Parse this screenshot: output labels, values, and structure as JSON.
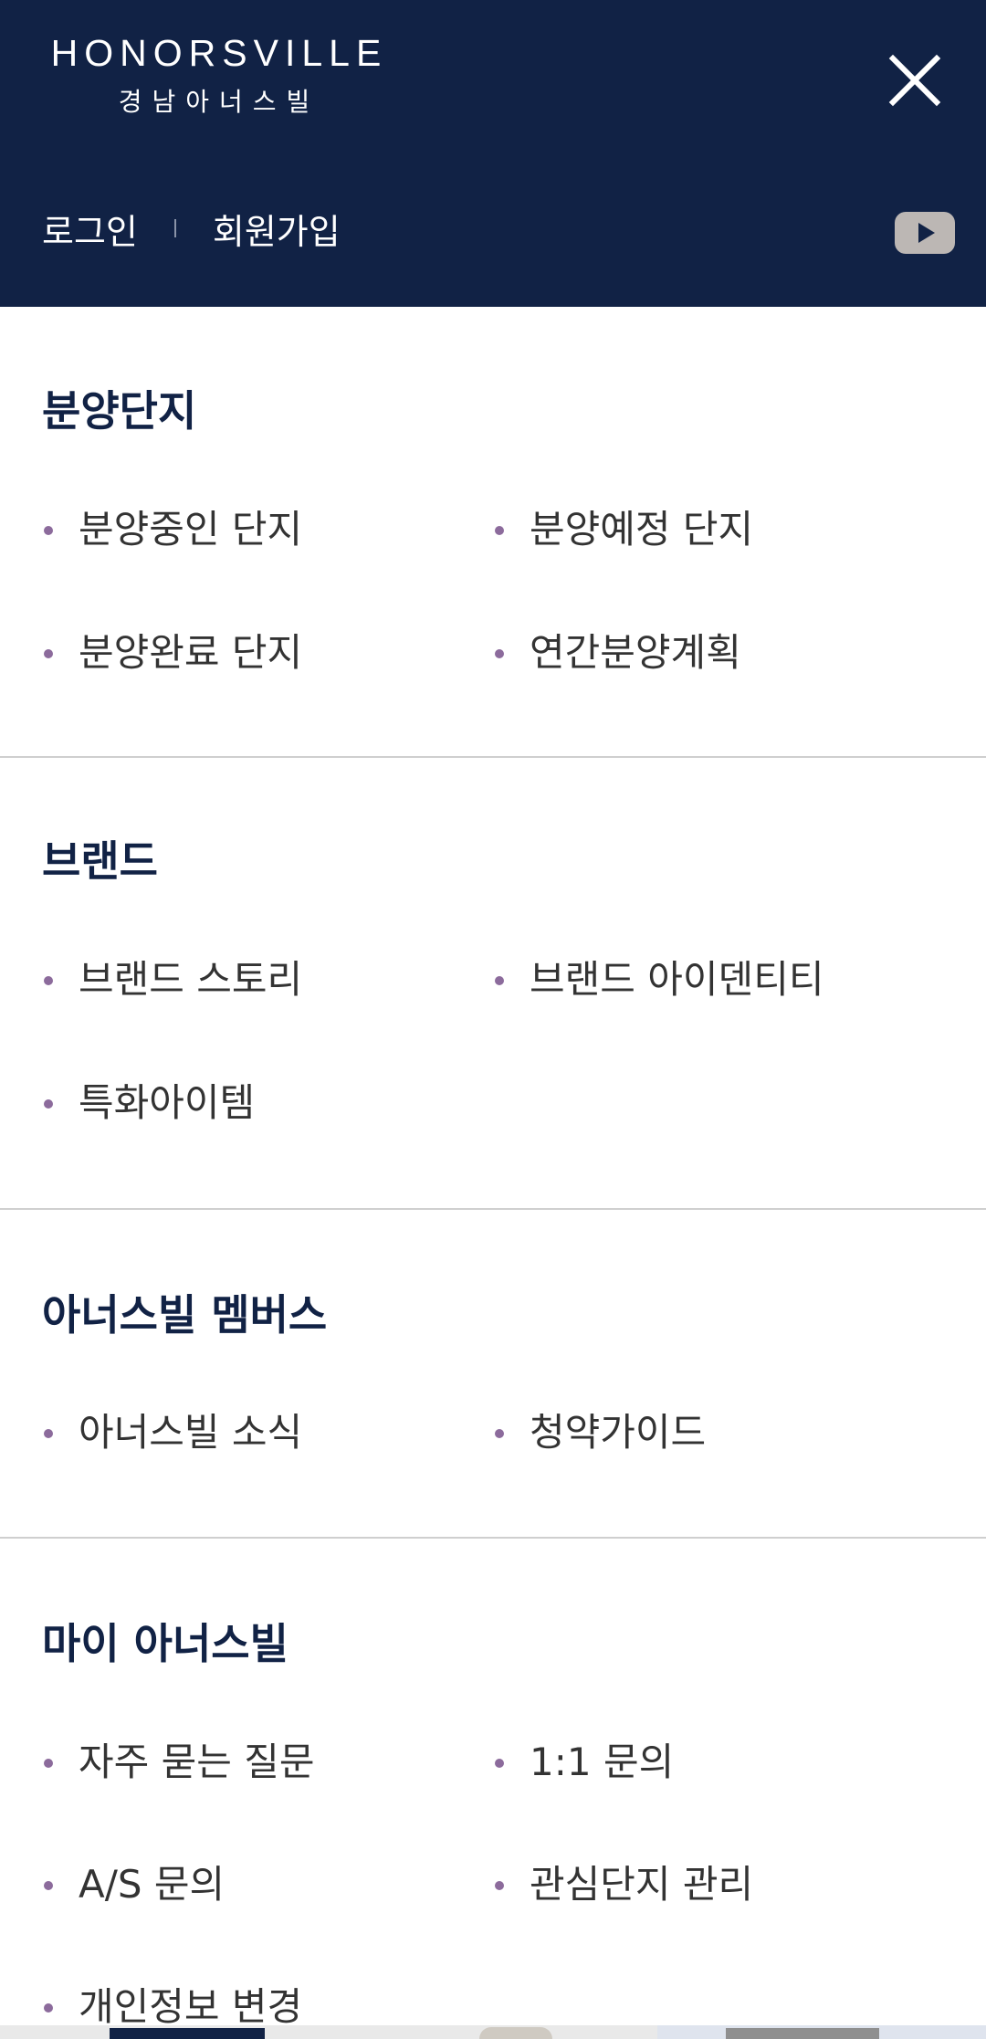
{
  "header": {
    "logo_en": "HONORSVILLE",
    "logo_ko": "경남아너스빌",
    "login": "로그인",
    "signup": "회원가입",
    "close_icon": "close-icon",
    "youtube_icon": "youtube-icon"
  },
  "menu": {
    "sections": [
      {
        "title": "분양단지",
        "items": [
          "분양중인 단지",
          "분양예정 단지",
          "분양완료 단지",
          "연간분양계획"
        ]
      },
      {
        "title": "브랜드",
        "items": [
          "브랜드 스토리",
          "브랜드 아이덴티티",
          "특화아이템"
        ]
      },
      {
        "title": "아너스빌 멤버스",
        "items": [
          "아너스빌 소식",
          "청약가이드"
        ]
      },
      {
        "title": "마이 아너스빌",
        "items": [
          "자주 묻는 질문",
          "1:1 문의",
          "A/S 문의",
          "관심단지 관리",
          "개인정보 변경"
        ]
      }
    ]
  },
  "colors": {
    "header_bg": "#112245",
    "title_text": "#112245",
    "bullet": "#8c6b9c",
    "youtube_badge": "#bcb7b4"
  }
}
